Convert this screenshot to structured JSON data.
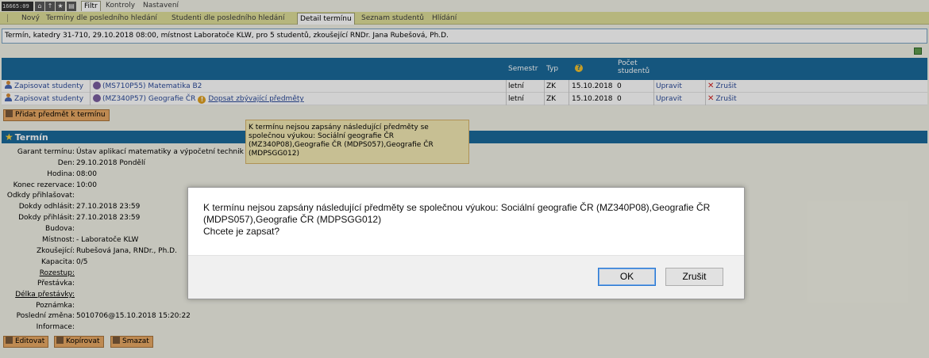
{
  "toolbar": {
    "session_id": "16665:09",
    "icons": [
      "home-icon",
      "up-arrow-icon",
      "star-icon",
      "print-icon"
    ],
    "tabs": [
      {
        "label": "Filtr",
        "active": true
      },
      {
        "label": "Kontroly",
        "active": false
      },
      {
        "label": "Nastavení",
        "active": false
      }
    ]
  },
  "subnav": {
    "tabs": [
      {
        "label": "Nový"
      },
      {
        "label": "Termíny dle posledního hledání"
      },
      {
        "label": "Studenti dle posledního hledání"
      },
      {
        "label": "Detail termínu",
        "active": true
      },
      {
        "label": "Seznam studentů"
      },
      {
        "label": "Hlídání"
      }
    ]
  },
  "header": {
    "info": "Termín, katedry 31-710, 29.10.2018 08:00, místnost Laboratoče KLW, pro 5 studentů, zkoušející RNDr. Jana Rubešová, Ph.D."
  },
  "table": {
    "columns": {
      "semestr": "Semestr",
      "typ": "Typ",
      "help": "?",
      "pocet": "Počet studentů"
    },
    "rows": [
      {
        "enroll": "Zapisovat studenty",
        "subject": "(MS710P55) Matematika B2",
        "extra": "",
        "semestr": "letní",
        "typ": "ZK",
        "date": "15.10.2018",
        "count": "0",
        "edit": "Upravit",
        "cancel": "Zrušit"
      },
      {
        "enroll": "Zapisovat studenty",
        "subject": "(MZ340P57) Geografie ČR",
        "extra": "Dopsat zbývající předměty",
        "semestr": "letní",
        "typ": "ZK",
        "date": "15.10.2018",
        "count": "0",
        "edit": "Upravit",
        "cancel": "Zrušit"
      }
    ],
    "add_subject_button": "Přidat předmět k termínu"
  },
  "tooltip": {
    "text": "K termínu nejsou zapsány následující předměty se společnou výukou: Sociální geografie ČR (MZ340P08),Geografie ČR (MDPS057),Geografie ČR (MDPSGG012)"
  },
  "section": {
    "title": "Termín",
    "fields": [
      {
        "label": "Garant termínu:",
        "value": "Ústav aplikací matematiky a výpočetní technik"
      },
      {
        "label": "Den:",
        "value": "29.10.2018 Pondělí"
      },
      {
        "label": "Hodina:",
        "value": "08:00"
      },
      {
        "label": "Konec rezervace:",
        "value": "10:00"
      },
      {
        "label": "Odkdy přihlašovat:",
        "value": ""
      },
      {
        "label": "Dokdy odhlásit:",
        "value": "27.10.2018 23:59"
      },
      {
        "label": "Dokdy přihlásit:",
        "value": "27.10.2018 23:59"
      },
      {
        "label": "Budova:",
        "value": ""
      },
      {
        "label": "Místnost:",
        "value": "- Laboratoče KLW"
      },
      {
        "label": "Zkoušející:",
        "value": "Rubešová Jana, RNDr., Ph.D."
      },
      {
        "label": "Kapacita:",
        "value": "0/5"
      },
      {
        "label": "Rozestup:",
        "value": ""
      },
      {
        "label": "Přestávka:",
        "value": ""
      },
      {
        "label": "Délka přestávky:",
        "value": ""
      },
      {
        "label": "Poznámka:",
        "value": ""
      },
      {
        "label": "Poslední změna:",
        "value": "5010706@15.10.2018 15:20:22"
      },
      {
        "label": "Informace:",
        "value": ""
      }
    ],
    "buttons": {
      "edit": "Editovat",
      "copy": "Kopírovat",
      "delete": "Smazat"
    }
  },
  "modal": {
    "message": "K termínu nejsou zapsány následující předměty se společnou výukou: Sociální geografie ČR (MZ340P08),Geografie ČR (MDPS057),Geografie ČR (MDPSGG012)",
    "question": "Chcete je zapsat?",
    "ok": "OK",
    "cancel": "Zrušit"
  }
}
